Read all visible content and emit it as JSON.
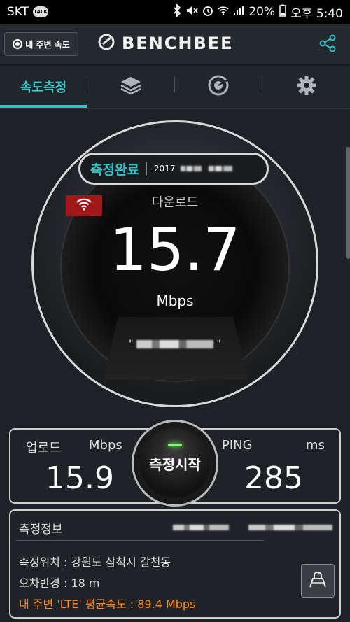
{
  "status_bar": {
    "carrier": "SKT",
    "talk_badge": "TALK",
    "battery": "20%",
    "time": "오후 5:40"
  },
  "app_bar": {
    "nearby_button": "내 주변 속도",
    "logo_text": "BENCHBEE",
    "icons": [
      "benchbee-logo-icon",
      "share-icon"
    ]
  },
  "tabs": [
    {
      "label": "속도측정",
      "active": true
    },
    {
      "icon": "layers-icon"
    },
    {
      "icon": "history-chart-icon"
    },
    {
      "icon": "settings-gear-icon"
    }
  ],
  "result": {
    "status": "측정완료",
    "date_prefix": "2017",
    "download_label": "다운로드",
    "download_value": "15.7",
    "download_unit": "Mbps",
    "ssid_quote": "\""
  },
  "stats": {
    "upload_label": "업로드",
    "upload_unit": "Mbps",
    "upload_value": "15.9",
    "ping_label": "PING",
    "ping_unit": "ms",
    "ping_value": "285",
    "start_button": "측정시작"
  },
  "info": {
    "title": "측정정보",
    "location": "측정위치 : 강원도 삼척시  갈천동",
    "error_radius": "오차반경 : 18 m",
    "avg_speed": "내 주변 'LTE' 평균속도 :  89.4 Mbps"
  },
  "colors": {
    "accent": "#30c4c4",
    "wifi_badge": "#a01818",
    "orange": "#ff8a1a",
    "start_led": "#7cff6a"
  }
}
